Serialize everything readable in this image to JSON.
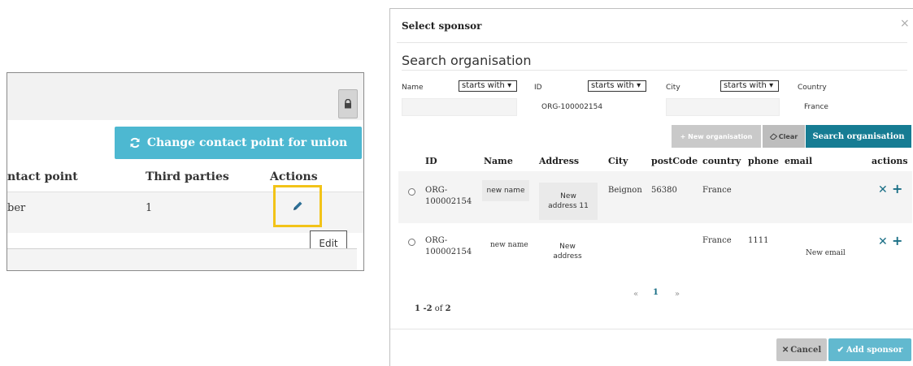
{
  "left_panel": {
    "change_button_label": "Change contact point for union",
    "columns": [
      "ntact point",
      "Third parties",
      "Actions"
    ],
    "row": {
      "contact": "ber",
      "third_parties": "1"
    },
    "edit_tooltip": "Edit",
    "highlight_color": "#f2c318"
  },
  "modal": {
    "title": "Select sponsor",
    "close_symbol": "×",
    "section_title": "Search organisation",
    "filters": {
      "name_label": "Name",
      "name_mode": "starts with ▾",
      "id_label": "ID",
      "id_mode": "starts with ▾",
      "id_value": "ORG-100002154",
      "city_label": "City",
      "city_mode": "starts with ▾",
      "country_label": "Country",
      "country_value": "France"
    },
    "buttons": {
      "new_org": "+ New organisation",
      "clear": "Clear",
      "search": "Search organisation",
      "cancel": "Cancel",
      "add_sponsor": "Add sponsor"
    },
    "columns": [
      "ID",
      "Name",
      "Address",
      "City",
      "postCode",
      "country",
      "phone",
      "email",
      "actions"
    ],
    "rows": [
      {
        "id_line1": "ORG-",
        "id_line2": "100002154",
        "name": "new name",
        "address_line1": "New",
        "address_line2": "address 11",
        "city": "Beignon",
        "postcode": "56380",
        "country": "France",
        "phone": "",
        "email": ""
      },
      {
        "id_line1": "ORG-",
        "id_line2": "100002154",
        "name": "new name",
        "address_line1": "New",
        "address_line2": "address",
        "city": "",
        "postcode": "",
        "country": "France",
        "phone": "1111",
        "email": "New email"
      }
    ],
    "pagination": {
      "prev": "«",
      "current": "1",
      "next": "»"
    },
    "range_text": "1 -2",
    "of_text": "of",
    "total": "2",
    "accent_color": "#167c93"
  }
}
